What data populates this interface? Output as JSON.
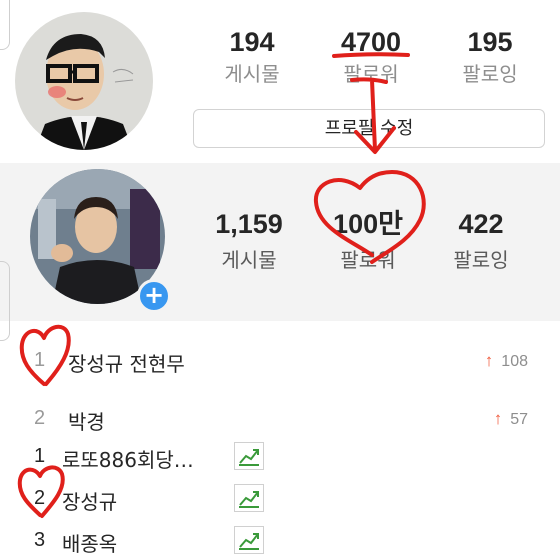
{
  "profile_1": {
    "stats": [
      {
        "value": "194",
        "label": "게시물"
      },
      {
        "value": "4700",
        "label": "팔로워"
      },
      {
        "value": "195",
        "label": "팔로잉"
      }
    ],
    "edit_button_label": "프로필 수정"
  },
  "profile_2": {
    "stats": [
      {
        "value": "1,159",
        "label": "게시물"
      },
      {
        "value": "100만",
        "label": "팔로워"
      },
      {
        "value": "422",
        "label": "팔로잉"
      }
    ],
    "add_badge": "+"
  },
  "trending": [
    {
      "rank": "1",
      "name": "장성규 전현무",
      "arrow": "↑",
      "change": "108"
    },
    {
      "rank": "2",
      "name": "박경",
      "arrow": "↑",
      "change": "57"
    }
  ],
  "keywords": [
    {
      "rank": "1",
      "name": "로또886회당…"
    },
    {
      "rank": "2",
      "name": "장성규"
    },
    {
      "rank": "3",
      "name": "배종옥"
    }
  ],
  "colors": {
    "accent_blue": "#3897f0",
    "trend_arrow": "#f05a3c",
    "chart_green": "#3a9a3a",
    "doodle_red": "#e0201b"
  }
}
